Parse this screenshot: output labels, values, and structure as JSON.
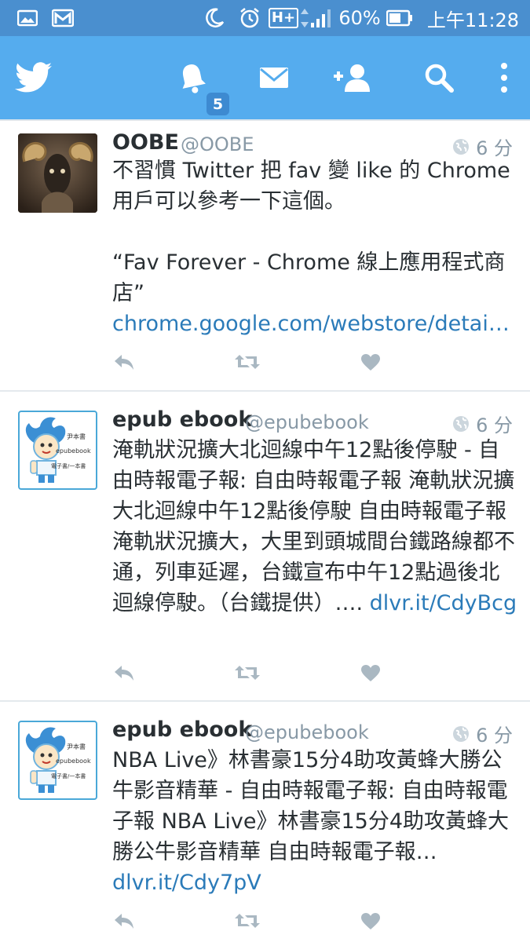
{
  "status_bar": {
    "battery_percent": "60%",
    "time": "上午11:28",
    "network": "H+"
  },
  "app_bar": {
    "notification_count": "5",
    "icons": [
      "twitter-bird-icon",
      "notifications-bell-icon",
      "messages-envelope-icon",
      "add-user-icon",
      "search-icon",
      "overflow-menu-icon"
    ]
  },
  "tweets": [
    {
      "name": "OOBE",
      "handle": "@OOBE",
      "time": "6 分",
      "text": "不習慣 Twitter 把 fav 變 like 的 Chrome 用戶可以參考一下這個。\n\n“Fav Forever - Chrome 線上應用程式商店” ",
      "link": "chrome.google.com/webstore/detai…"
    },
    {
      "name": "epub ebook",
      "handle": "@epubebook",
      "time": "6 分",
      "text": "淹軌狀況擴大北迴線中午12點後停駛 - 自由時報電子報: 自由時報電子報 淹軌狀況擴大北迴線中午12點後停駛 自由時報電子報 淹軌狀況擴大，大里到頭城間台鐵路線都不通，列車延遲，台鐵宣布中午12點過後北迴線停駛。（台鐵提供）…. ",
      "link": "dlvr.it/CdyBcg"
    },
    {
      "name": "epub ebook",
      "handle": "@epubebook",
      "time": "6 分",
      "text": "NBA Live》林書豪15分4助攻黃蜂大勝公牛影音精華 - 自由時報電子報: 自由時報電子報 NBA Live》林書豪15分4助攻黃蜂大勝公牛影音精華 自由時報電子報… ",
      "link": "dlvr.it/Cdy7pV"
    }
  ],
  "avatar_epub": {
    "line1": "尹本書",
    "line2": "epubebook",
    "line3": "電子書/一本書"
  },
  "colors": {
    "app_bar": "#55acee",
    "status_bar": "#4a8fcf",
    "link": "#2b7bb9",
    "muted": "#8899a6"
  }
}
